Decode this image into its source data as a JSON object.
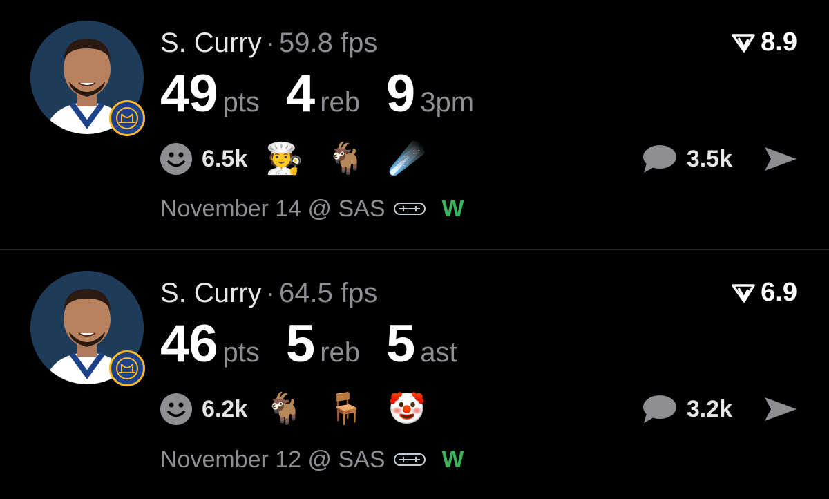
{
  "cards": [
    {
      "player": "S. Curry",
      "separator": "·",
      "fps": "59.8 fps",
      "rating": "8.9",
      "stats": [
        {
          "value": "49",
          "label": "pts"
        },
        {
          "value": "4",
          "label": "reb"
        },
        {
          "value": "9",
          "label": "3pm"
        }
      ],
      "reactions": "6.5k",
      "emojis": [
        "🧑‍🍳",
        "🐐",
        "☄️"
      ],
      "comments": "3.5k",
      "date": "November 14 @ SAS",
      "result": "W"
    },
    {
      "player": "S. Curry",
      "separator": "·",
      "fps": "64.5 fps",
      "rating": "6.9",
      "stats": [
        {
          "value": "46",
          "label": "pts"
        },
        {
          "value": "5",
          "label": "reb"
        },
        {
          "value": "5",
          "label": "ast"
        }
      ],
      "reactions": "6.2k",
      "emojis": [
        "🐐",
        "🪑",
        "🤡"
      ],
      "comments": "3.2k",
      "date": "November 12 @ SAS",
      "result": "W"
    }
  ],
  "colors": {
    "background": "#000000",
    "secondary_text": "#8e8e93",
    "win": "#3cb35d",
    "team_primary": "#1d428a",
    "team_secondary": "#fdb927"
  },
  "icons": [
    "player-avatar",
    "warriors-logo-icon",
    "rating-icon",
    "reaction-smiley-icon",
    "comment-bubble-icon",
    "send-icon",
    "spurs-logo-icon"
  ]
}
